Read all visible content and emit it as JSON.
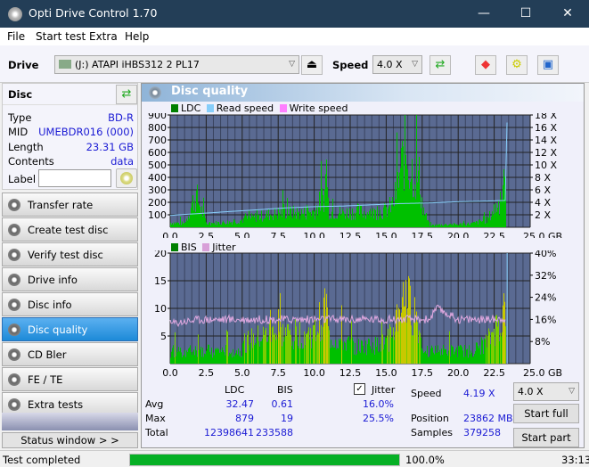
{
  "window": {
    "title": "Opti Drive Control 1.70",
    "minimize": "—",
    "maximize": "☐",
    "close": "✕"
  },
  "menu": [
    "File",
    "Start test",
    "Extra",
    "Help"
  ],
  "toolbar": {
    "drive_label": "Drive",
    "drive_value": "(J:)  ATAPI iHBS312  2 PL17",
    "speed_label": "Speed",
    "speed_value": "4.0 X"
  },
  "disc": {
    "header": "Disc",
    "type_label": "Type",
    "type": "BD-R",
    "mid_label": "MID",
    "mid": "UMEBDR016 (000)",
    "length_label": "Length",
    "length": "23.31 GB",
    "contents_label": "Contents",
    "contents": "data",
    "label_label": "Label",
    "label_value": ""
  },
  "nav": [
    {
      "label": "Transfer rate"
    },
    {
      "label": "Create test disc"
    },
    {
      "label": "Verify test disc"
    },
    {
      "label": "Drive info"
    },
    {
      "label": "Disc info"
    },
    {
      "label": "Disc quality",
      "active": true
    },
    {
      "label": "CD Bler"
    },
    {
      "label": "FE / TE"
    },
    {
      "label": "Extra tests"
    }
  ],
  "status_window_label": "Status window > >",
  "panel_title": "Disc quality",
  "chart_data": [
    {
      "type": "area",
      "title": "LDC chart",
      "legend": [
        "LDC",
        "Read speed",
        "Write speed"
      ],
      "legend_colors": [
        "#008000",
        "#87cefa",
        "#ff80ff"
      ],
      "xlabel": "GB",
      "xlim": [
        0,
        25
      ],
      "x_ticks": [
        "0.0",
        "2.5",
        "5.0",
        "7.5",
        "10.0",
        "12.5",
        "15.0",
        "17.5",
        "20.0",
        "22.5",
        "25.0 GB"
      ],
      "ylim": [
        0,
        900
      ],
      "y_ticks": [
        "100",
        "200",
        "300",
        "400",
        "500",
        "600",
        "700",
        "800",
        "900"
      ],
      "y2lim": [
        0,
        18
      ],
      "y2_ticks": [
        "2 X",
        "4 X",
        "6 X",
        "8 X",
        "10 X",
        "12 X",
        "14 X",
        "16 X",
        "18 X"
      ],
      "series": [
        {
          "name": "LDC",
          "x": [
            0,
            1,
            1.6,
            1.8,
            2.5,
            3.5,
            4.5,
            5,
            6,
            7,
            8,
            9,
            10,
            10.7,
            10.8,
            11,
            12,
            13,
            14,
            15,
            15.5,
            16,
            16.3,
            16.6,
            17,
            17.3,
            17.5,
            18,
            19,
            20,
            21,
            22,
            22.5,
            23,
            23.3
          ],
          "values": [
            50,
            40,
            290,
            330,
            40,
            50,
            60,
            80,
            110,
            140,
            160,
            150,
            170,
            350,
            570,
            170,
            150,
            170,
            150,
            180,
            260,
            620,
            820,
            650,
            550,
            520,
            200,
            20,
            30,
            30,
            40,
            80,
            200,
            300,
            410
          ]
        },
        {
          "name": "Read speed",
          "x": [
            0,
            2,
            4,
            6,
            8,
            10,
            12,
            14,
            16,
            18,
            20,
            22,
            23.3,
            23.4
          ],
          "values": [
            1.9,
            2.2,
            2.5,
            2.8,
            3.1,
            3.3,
            3.4,
            3.6,
            3.8,
            3.9,
            4.1,
            4.2,
            4.3,
            18
          ]
        }
      ]
    },
    {
      "type": "area",
      "title": "BIS chart",
      "legend": [
        "BIS",
        "Jitter"
      ],
      "legend_colors": [
        "#008000",
        "#d8a0d8"
      ],
      "xlabel": "GB",
      "xlim": [
        0,
        25
      ],
      "x_ticks": [
        "0.0",
        "2.5",
        "5.0",
        "7.5",
        "10.0",
        "12.5",
        "15.0",
        "17.5",
        "20.0",
        "22.5",
        "25.0 GB"
      ],
      "ylim": [
        0,
        20
      ],
      "y_ticks": [
        "5",
        "10",
        "15",
        "20"
      ],
      "y2lim": [
        0,
        40
      ],
      "y2_ticks": [
        "8%",
        "16%",
        "24%",
        "32%",
        "40%"
      ],
      "series": [
        {
          "name": "BIS",
          "x": [
            0,
            1,
            2,
            3,
            4,
            5,
            5.1,
            6,
            7,
            8,
            9,
            10,
            10.8,
            11,
            12,
            13,
            14,
            15,
            15.5,
            16,
            16.5,
            17,
            17.5,
            18,
            19,
            20,
            21,
            22,
            22.5,
            23,
            23.3
          ],
          "values": [
            3,
            3,
            3,
            3,
            3,
            3,
            5,
            6,
            7,
            7,
            7,
            7,
            14,
            6,
            5,
            4,
            4,
            5,
            8,
            15,
            14,
            12,
            4,
            3,
            3,
            3,
            3,
            5,
            8,
            10,
            15
          ]
        },
        {
          "name": "Jitter",
          "x": [
            0,
            2,
            4,
            6,
            8,
            10,
            12,
            14,
            16,
            18,
            18.5,
            20,
            22,
            23.3
          ],
          "values": [
            14.5,
            16,
            16,
            16,
            16,
            16,
            16,
            16,
            16,
            16,
            20,
            16,
            16,
            16.5
          ]
        }
      ]
    }
  ],
  "stats": {
    "col_ldc": "LDC",
    "col_bis": "BIS",
    "jitter_label": "Jitter",
    "jitter_checked": true,
    "rows": [
      {
        "label": "Avg",
        "ldc": "32.47",
        "bis": "0.61",
        "jitter": "16.0%"
      },
      {
        "label": "Max",
        "ldc": "879",
        "bis": "19",
        "jitter": "25.5%"
      },
      {
        "label": "Total",
        "ldc": "12398641",
        "bis": "233588",
        "jitter": ""
      }
    ],
    "speed_label": "Speed",
    "speed_value": "4.19 X",
    "position_label": "Position",
    "position_value": "23862 MB",
    "samples_label": "Samples",
    "samples_value": "379258",
    "speed_select": "4.0 X",
    "start_full": "Start full",
    "start_part": "Start part"
  },
  "statusbar": {
    "text": "Test completed",
    "progress": 100.0,
    "progress_text": "100.0%",
    "time": "33:13"
  }
}
